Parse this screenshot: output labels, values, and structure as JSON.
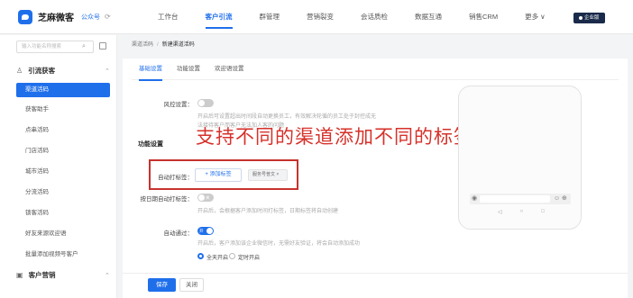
{
  "header": {
    "brand": "芝麻微客",
    "gzh_label": "公众号",
    "nav_items": [
      "工作台",
      "客户引流",
      "群管理",
      "营销裂变",
      "会话质检",
      "数据互通",
      "销售CRM",
      "更多 ∨"
    ],
    "active_nav": "客户引流",
    "org_badge": "企业版"
  },
  "sidebar": {
    "search_placeholder": "输入功能名称搜索",
    "group1": "引流获客",
    "items": [
      "渠道活码",
      "获客助手",
      "点串活码",
      "门店活码",
      "城市活码",
      "分流活码",
      "锁客活码",
      "好友来源欢迎语",
      "批量添加视频号客户"
    ],
    "active_item": "渠道活码",
    "group2": "客户营销"
  },
  "breadcrumb": {
    "parent": "渠道活码",
    "current": "新建渠道活码"
  },
  "tabs": [
    "基础设置",
    "功能设置",
    "欢迎语设置"
  ],
  "form": {
    "risk_label": "风控设置：",
    "risk_hint_1": "开启后可设置超出时间段自动更换员工，有效解决轮循的员工处于封控成无",
    "risk_hint_2": "法接待客户而客户无法加人客的问题",
    "section_title": "功能设置",
    "auto_tag_label": "自动打标签：",
    "add_tag_button": "+ 添加标签",
    "tag_chip": "服务号普文 ×",
    "date_tag_label": "按日期自动打标签：",
    "date_tag_toggle": "关",
    "date_tag_hint": "开启后，会根据客户添加时间打标签，日期标签将自动创建",
    "auto_pass_label": "自动通过：",
    "auto_pass_toggle": "开",
    "auto_pass_hint": "开启后，客户添加该企业微信时，无需好友验证，将会自动添加成功",
    "radio_all_day": "全天开启",
    "radio_timed": "定时开启"
  },
  "overlay_caption": "支持不同的渠道添加不同的标签",
  "phone": {
    "nav_icons": [
      "◁",
      "○",
      "□"
    ]
  },
  "footer": {
    "save_label": "保存",
    "close_label": "关闭"
  },
  "colors": {
    "accent": "#1f6feb",
    "overlay_red": "#d6312a"
  }
}
